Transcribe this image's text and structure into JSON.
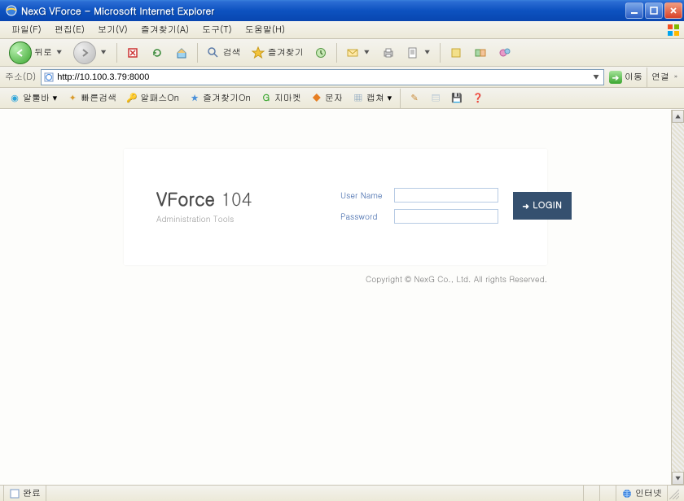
{
  "window": {
    "title": "NexG VForce - Microsoft Internet Explorer"
  },
  "menu": {
    "items": [
      "파일(F)",
      "편집(E)",
      "보기(V)",
      "즐겨찾기(A)",
      "도구(T)",
      "도움말(H)"
    ]
  },
  "toolbar": {
    "back": "뒤로",
    "search": "검색",
    "favorites": "즐겨찾기"
  },
  "address": {
    "label": "주소(D)",
    "url": "http://10.100.3.79:8000",
    "go": "이동",
    "links": "연결"
  },
  "linkbar": {
    "items": [
      {
        "icon": "altools",
        "label": "알툴바 ▾",
        "color": "#2aa3d9"
      },
      {
        "icon": "quick",
        "label": "빠른검색",
        "color": "#d99a2a"
      },
      {
        "icon": "alpass",
        "label": "알패스On",
        "color": "#e0b43c"
      },
      {
        "icon": "fav",
        "label": "즐겨찾기On",
        "color": "#4a90d9"
      },
      {
        "icon": "gmarket",
        "label": "지마켓",
        "color": "#3aa62f"
      },
      {
        "icon": "munja",
        "label": "문자",
        "color": "#e67e22"
      },
      {
        "icon": "capture",
        "label": "캡쳐 ▾",
        "color": "#6b8fb3"
      }
    ]
  },
  "login": {
    "brand_strong": "VForce",
    "brand_num": " 104",
    "brand_sub": "Administration Tools",
    "username_label": "User Name",
    "password_label": "Password",
    "button": "LOGIN"
  },
  "footer": {
    "copyright": "Copyright © NexG Co., Ltd. All rights Reserved."
  },
  "status": {
    "left": "완료",
    "zone": "인터넷"
  }
}
